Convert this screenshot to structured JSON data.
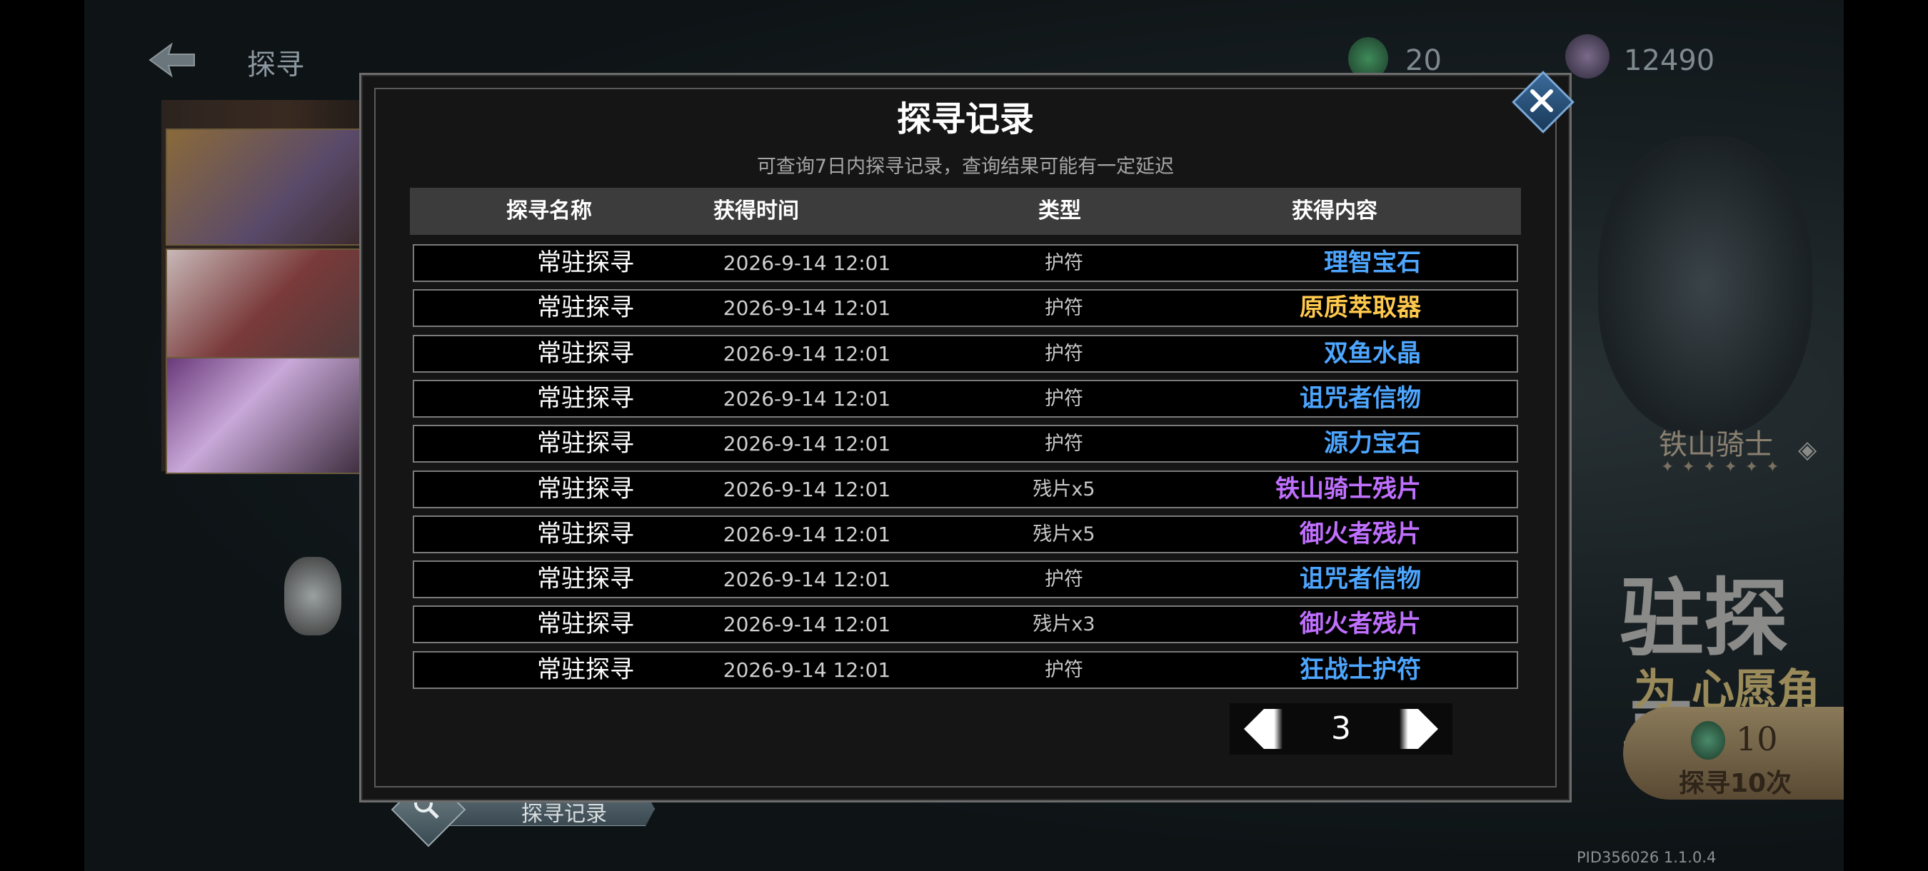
{
  "background": {
    "screen_title": "探寻",
    "currency_1": "20",
    "currency_2": "12490",
    "featured_name": "铁山骑士",
    "banner_title": "驻探寻",
    "banner_subtitle": "为 心愿角色！",
    "pull_cost": "10",
    "pull_label": "探寻10次",
    "record_button_label": "探寻记录",
    "pid": "PID356026  1.1.0.4"
  },
  "modal": {
    "title": "探寻记录",
    "subtitle": "可查询7日内探寻记录，查询结果可能有一定延迟",
    "columns": [
      "探寻名称",
      "获得时间",
      "类型",
      "获得内容"
    ],
    "rows": [
      {
        "name": "常驻探寻",
        "time": "2026-9-14 12:01",
        "type": "护符",
        "item": "理智宝石",
        "color": "#4da6ff"
      },
      {
        "name": "常驻探寻",
        "time": "2026-9-14 12:01",
        "type": "护符",
        "item": "原质萃取器",
        "color": "#ffc94d"
      },
      {
        "name": "常驻探寻",
        "time": "2026-9-14 12:01",
        "type": "护符",
        "item": "双鱼水晶",
        "color": "#4da6ff"
      },
      {
        "name": "常驻探寻",
        "time": "2026-9-14 12:01",
        "type": "护符",
        "item": "诅咒者信物",
        "color": "#4da6ff"
      },
      {
        "name": "常驻探寻",
        "time": "2026-9-14 12:01",
        "type": "护符",
        "item": "源力宝石",
        "color": "#4da6ff"
      },
      {
        "name": "常驻探寻",
        "time": "2026-9-14 12:01",
        "type": "残片x5",
        "item": "铁山骑士残片",
        "color": "#c070ff"
      },
      {
        "name": "常驻探寻",
        "time": "2026-9-14 12:01",
        "type": "残片x5",
        "item": "御火者残片",
        "color": "#c070ff"
      },
      {
        "name": "常驻探寻",
        "time": "2026-9-14 12:01",
        "type": "护符",
        "item": "诅咒者信物",
        "color": "#4da6ff"
      },
      {
        "name": "常驻探寻",
        "time": "2026-9-14 12:01",
        "type": "残片x3",
        "item": "御火者残片",
        "color": "#c070ff"
      },
      {
        "name": "常驻探寻",
        "time": "2026-9-14 12:01",
        "type": "护符",
        "item": "狂战士护符",
        "color": "#4da6ff"
      }
    ],
    "page": "3"
  },
  "icons": {
    "close": "close-icon",
    "prev": "arrow-left-icon",
    "next": "arrow-right-icon",
    "search": "magnifier-icon",
    "back": "back-arrow-icon"
  }
}
